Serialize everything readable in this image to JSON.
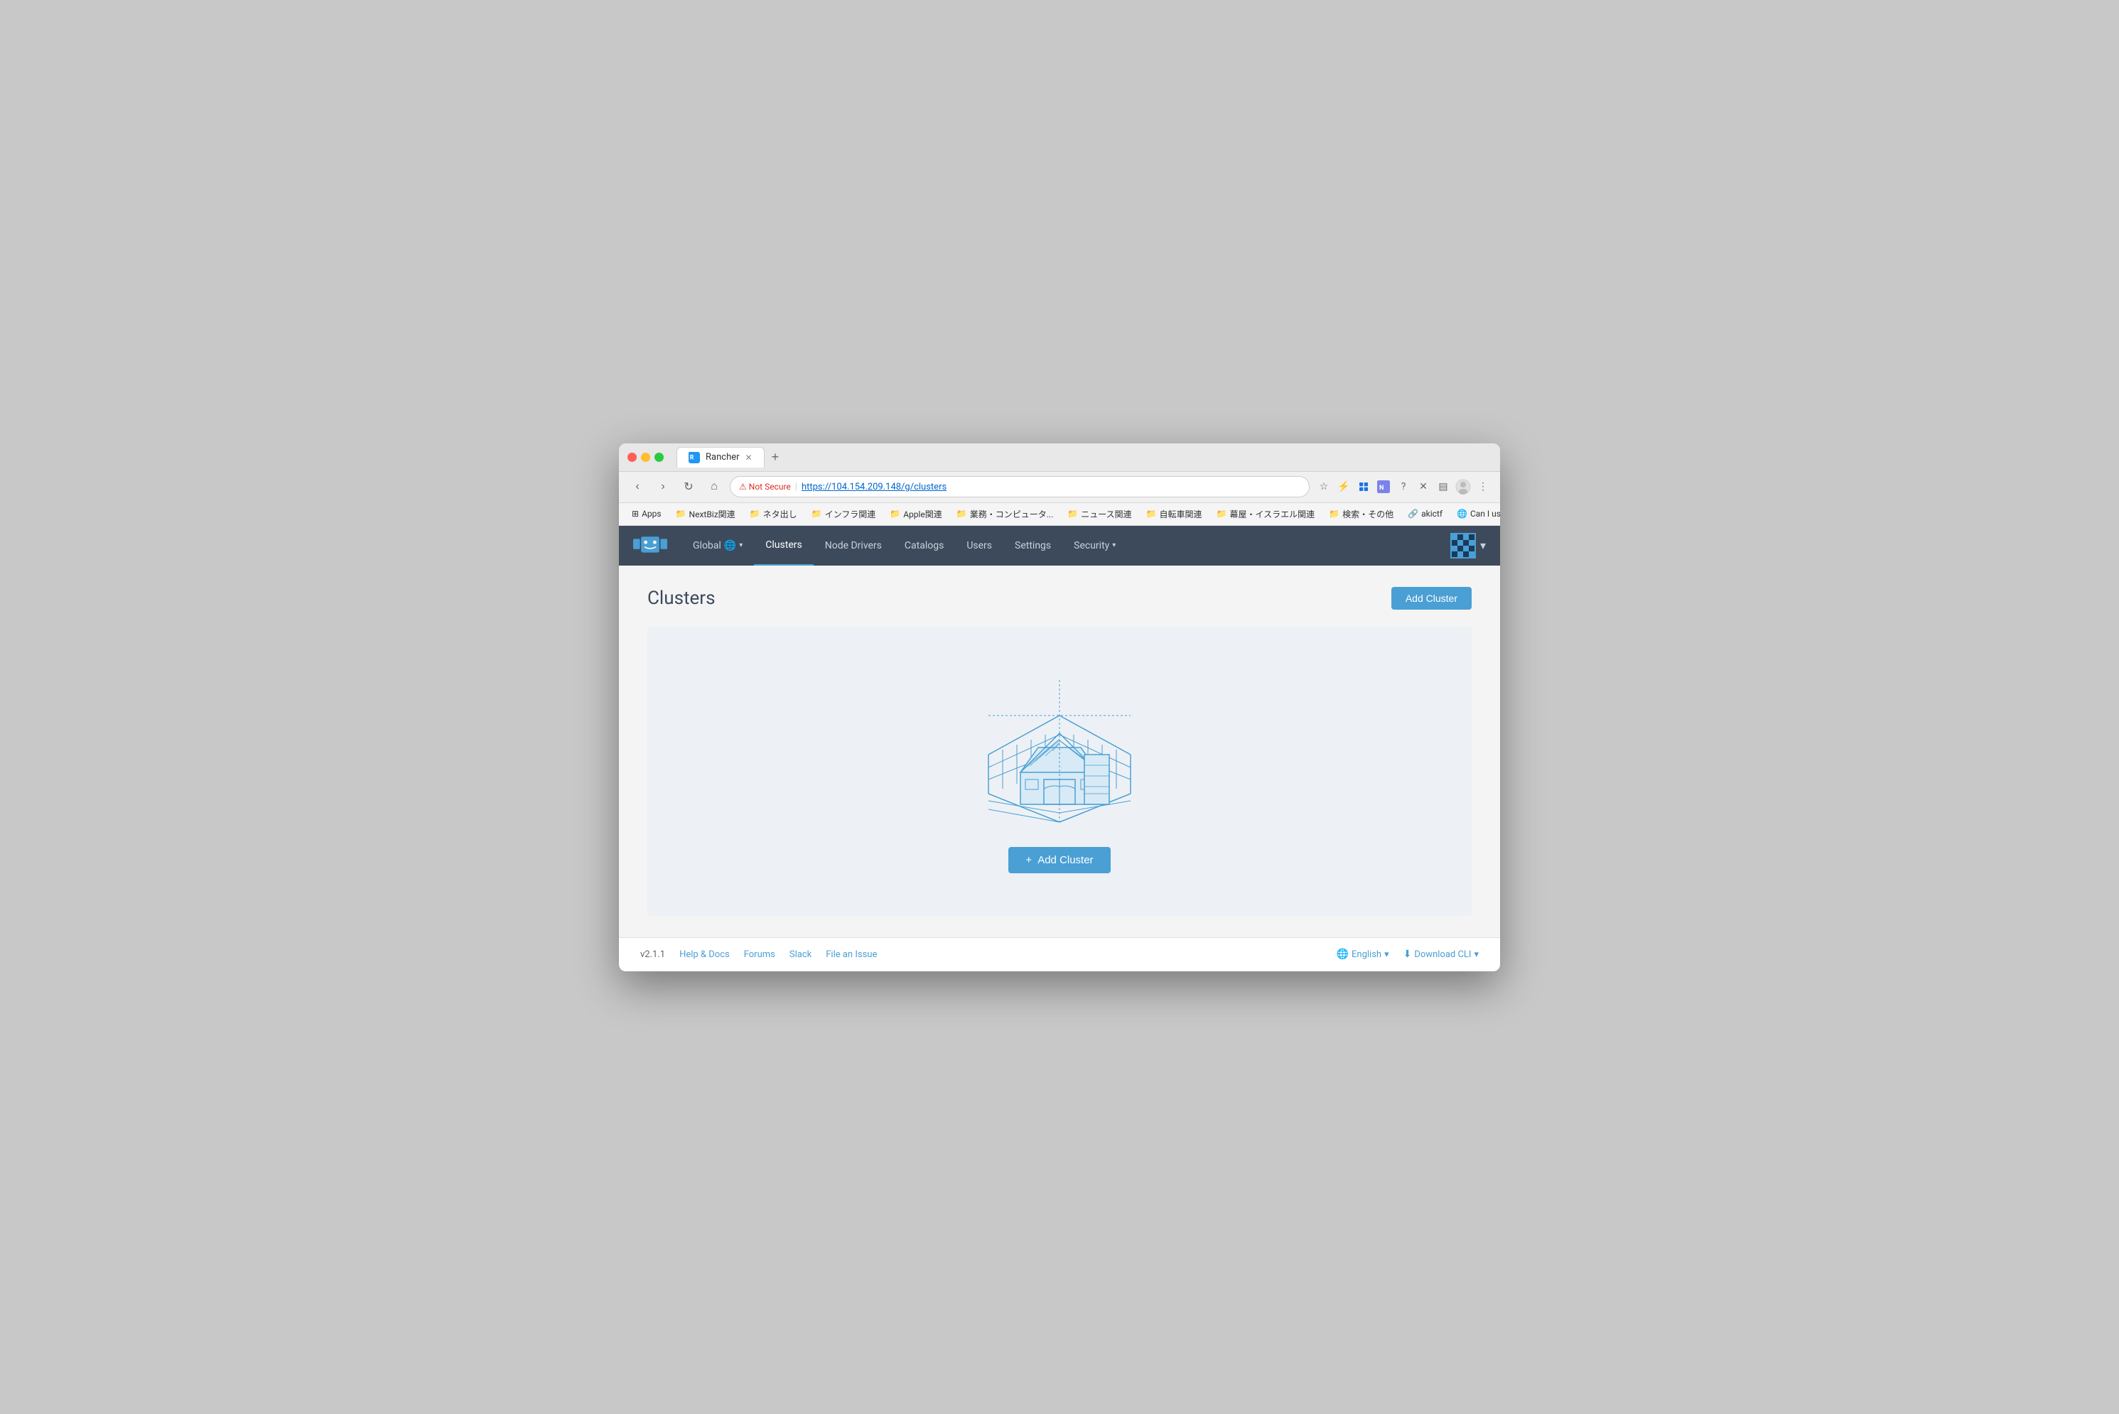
{
  "browser": {
    "tab": {
      "title": "Rancher",
      "favicon": "rancher"
    },
    "address": {
      "not_secure_label": "Not Secure",
      "url": "https://104.154.209.148/g/clusters"
    },
    "bookmarks": [
      {
        "id": "apps",
        "label": "Apps",
        "type": "apps"
      },
      {
        "id": "nextbiz",
        "label": "NextBiz関連",
        "type": "folder"
      },
      {
        "id": "neta",
        "label": "ネタ出し",
        "type": "folder"
      },
      {
        "id": "infra",
        "label": "インフラ関連",
        "type": "folder"
      },
      {
        "id": "apple",
        "label": "Apple関連",
        "type": "folder"
      },
      {
        "id": "business",
        "label": "業務・コンピュータ...",
        "type": "folder"
      },
      {
        "id": "news",
        "label": "ニュース関連",
        "type": "folder"
      },
      {
        "id": "bicycle",
        "label": "自転車関連",
        "type": "folder"
      },
      {
        "id": "makuya",
        "label": "幕屋・イスラエル関連",
        "type": "folder"
      },
      {
        "id": "search",
        "label": "検索・その他",
        "type": "folder"
      },
      {
        "id": "akictf",
        "label": "akictf",
        "type": "link"
      },
      {
        "id": "canuse",
        "label": "Can I use... Suppo...",
        "type": "link"
      }
    ]
  },
  "nav": {
    "global_label": "Global",
    "items": [
      {
        "id": "clusters",
        "label": "Clusters",
        "active": true
      },
      {
        "id": "node-drivers",
        "label": "Node Drivers",
        "active": false
      },
      {
        "id": "catalogs",
        "label": "Catalogs",
        "active": false
      },
      {
        "id": "users",
        "label": "Users",
        "active": false
      },
      {
        "id": "settings",
        "label": "Settings",
        "active": false
      },
      {
        "id": "security",
        "label": "Security",
        "active": false,
        "has_dropdown": true
      }
    ]
  },
  "page": {
    "title": "Clusters",
    "add_cluster_button": "Add Cluster",
    "add_cluster_center_button": "Add Cluster"
  },
  "footer": {
    "version": "v2.1.1",
    "links": [
      {
        "id": "help",
        "label": "Help & Docs"
      },
      {
        "id": "forums",
        "label": "Forums"
      },
      {
        "id": "slack",
        "label": "Slack"
      },
      {
        "id": "issue",
        "label": "File an Issue"
      }
    ],
    "language": "English",
    "cli": "Download CLI"
  }
}
